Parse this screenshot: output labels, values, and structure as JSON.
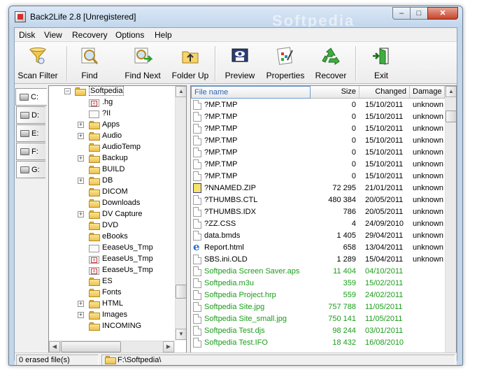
{
  "window": {
    "title": "Back2Life 2.8 [Unregistered]",
    "watermark": "Softpedia",
    "min_label": "–",
    "max_label": "□",
    "close_label": "✕"
  },
  "menu": [
    "Disk",
    "View",
    "Recovery",
    "Options",
    "Help"
  ],
  "toolbar": [
    {
      "name": "scan-filter",
      "label": "Scan Filter",
      "icon": "funnel-icon"
    },
    {
      "name": "find",
      "label": "Find",
      "icon": "magnifier-icon"
    },
    {
      "name": "find-next",
      "label": "Find Next",
      "icon": "find-next-icon"
    },
    {
      "name": "folder-up",
      "label": "Folder Up",
      "icon": "folder-up-icon"
    },
    {
      "name": "preview",
      "label": "Preview",
      "icon": "hex-preview-icon"
    },
    {
      "name": "properties",
      "label": "Properties",
      "icon": "properties-icon"
    },
    {
      "name": "recover",
      "label": "Recover",
      "icon": "recycle-icon"
    },
    {
      "name": "exit",
      "label": "Exit",
      "icon": "exit-door-icon"
    }
  ],
  "drives": [
    "C:",
    "D:",
    "E:",
    "F:",
    "G:"
  ],
  "tree": {
    "root": "Softpedia",
    "items": [
      {
        "label": ".hg",
        "expand": false,
        "erased": true
      },
      {
        "label": "?II",
        "expand": false,
        "erased": false,
        "plain": true
      },
      {
        "label": "Apps",
        "expand": true,
        "erased": false
      },
      {
        "label": "Audio",
        "expand": true,
        "erased": false
      },
      {
        "label": "AudioTemp",
        "expand": false,
        "erased": false
      },
      {
        "label": "Backup",
        "expand": true,
        "erased": false
      },
      {
        "label": "BUILD",
        "expand": false,
        "erased": false
      },
      {
        "label": "DB",
        "expand": true,
        "erased": false
      },
      {
        "label": "DICOM",
        "expand": false,
        "erased": false
      },
      {
        "label": "Downloads",
        "expand": false,
        "erased": false
      },
      {
        "label": "DV Capture",
        "expand": true,
        "erased": false
      },
      {
        "label": "DVD",
        "expand": false,
        "erased": false
      },
      {
        "label": "eBooks",
        "expand": false,
        "erased": false
      },
      {
        "label": "EeaseUs_Tmp",
        "expand": false,
        "erased": false,
        "plain": true
      },
      {
        "label": "EeaseUs_Tmp",
        "expand": false,
        "erased": true
      },
      {
        "label": "EeaseUs_Tmp",
        "expand": false,
        "erased": true
      },
      {
        "label": "ES",
        "expand": false,
        "erased": false
      },
      {
        "label": "Fonts",
        "expand": false,
        "erased": false
      },
      {
        "label": "HTML",
        "expand": true,
        "erased": false
      },
      {
        "label": "Images",
        "expand": true,
        "erased": false
      },
      {
        "label": "INCOMING",
        "expand": false,
        "erased": false
      }
    ]
  },
  "files": {
    "columns": [
      "File name",
      "Size",
      "Changed",
      "Damage"
    ],
    "rows": [
      {
        "name": "?MP.TMP",
        "size": "0",
        "changed": "15/10/2011",
        "damage": "unknown",
        "icon": "file",
        "rec": false
      },
      {
        "name": "?MP.TMP",
        "size": "0",
        "changed": "15/10/2011",
        "damage": "unknown",
        "icon": "file",
        "rec": false
      },
      {
        "name": "?MP.TMP",
        "size": "0",
        "changed": "15/10/2011",
        "damage": "unknown",
        "icon": "file",
        "rec": false
      },
      {
        "name": "?MP.TMP",
        "size": "0",
        "changed": "15/10/2011",
        "damage": "unknown",
        "icon": "file",
        "rec": false
      },
      {
        "name": "?MP.TMP",
        "size": "0",
        "changed": "15/10/2011",
        "damage": "unknown",
        "icon": "file",
        "rec": false
      },
      {
        "name": "?MP.TMP",
        "size": "0",
        "changed": "15/10/2011",
        "damage": "unknown",
        "icon": "file",
        "rec": false
      },
      {
        "name": "?MP.TMP",
        "size": "0",
        "changed": "15/10/2011",
        "damage": "unknown",
        "icon": "file",
        "rec": false
      },
      {
        "name": "?NNAMED.ZIP",
        "size": "72 295",
        "changed": "21/01/2011",
        "damage": "unknown",
        "icon": "zip",
        "rec": false
      },
      {
        "name": "?THUMBS.CTL",
        "size": "480 384",
        "changed": "20/05/2011",
        "damage": "unknown",
        "icon": "file",
        "rec": false
      },
      {
        "name": "?THUMBS.IDX",
        "size": "786",
        "changed": "20/05/2011",
        "damage": "unknown",
        "icon": "file",
        "rec": false
      },
      {
        "name": "?ZZ.CSS",
        "size": "4",
        "changed": "24/09/2010",
        "damage": "unknown",
        "icon": "file",
        "rec": false
      },
      {
        "name": "data.bmds",
        "size": "1 405",
        "changed": "29/04/2011",
        "damage": "unknown",
        "icon": "file",
        "rec": false
      },
      {
        "name": "Report.html",
        "size": "658",
        "changed": "13/04/2011",
        "damage": "unknown",
        "icon": "ie",
        "rec": false
      },
      {
        "name": "SBS.ini.OLD",
        "size": "1 289",
        "changed": "15/04/2011",
        "damage": "unknown",
        "icon": "file",
        "rec": false
      },
      {
        "name": "Softpedia Screen Saver.aps",
        "size": "11 404",
        "changed": "04/10/2011",
        "damage": "",
        "icon": "file",
        "rec": true
      },
      {
        "name": "Softpedia.m3u",
        "size": "359",
        "changed": "15/02/2011",
        "damage": "",
        "icon": "file",
        "rec": true
      },
      {
        "name": "Softpedia Project.hrp",
        "size": "559",
        "changed": "24/02/2011",
        "damage": "",
        "icon": "file",
        "rec": true
      },
      {
        "name": "Softpedia Site.jpg",
        "size": "757 788",
        "changed": "11/05/2011",
        "damage": "",
        "icon": "file",
        "rec": true
      },
      {
        "name": "Softpedia Site_small.jpg",
        "size": "750 141",
        "changed": "11/05/2011",
        "damage": "",
        "icon": "file",
        "rec": true
      },
      {
        "name": "Softpedia Test.djs",
        "size": "98 244",
        "changed": "03/01/2011",
        "damage": "",
        "icon": "file",
        "rec": true
      },
      {
        "name": "Softpedia Test.IFO",
        "size": "18 432",
        "changed": "16/08/2010",
        "damage": "",
        "icon": "file",
        "rec": true
      }
    ]
  },
  "status": {
    "count": "0  erased file(s)",
    "path": "F:\\Softpedia\\"
  },
  "colors": {
    "recoverable": "#1b9c1b",
    "accent": "#2e63b4"
  }
}
